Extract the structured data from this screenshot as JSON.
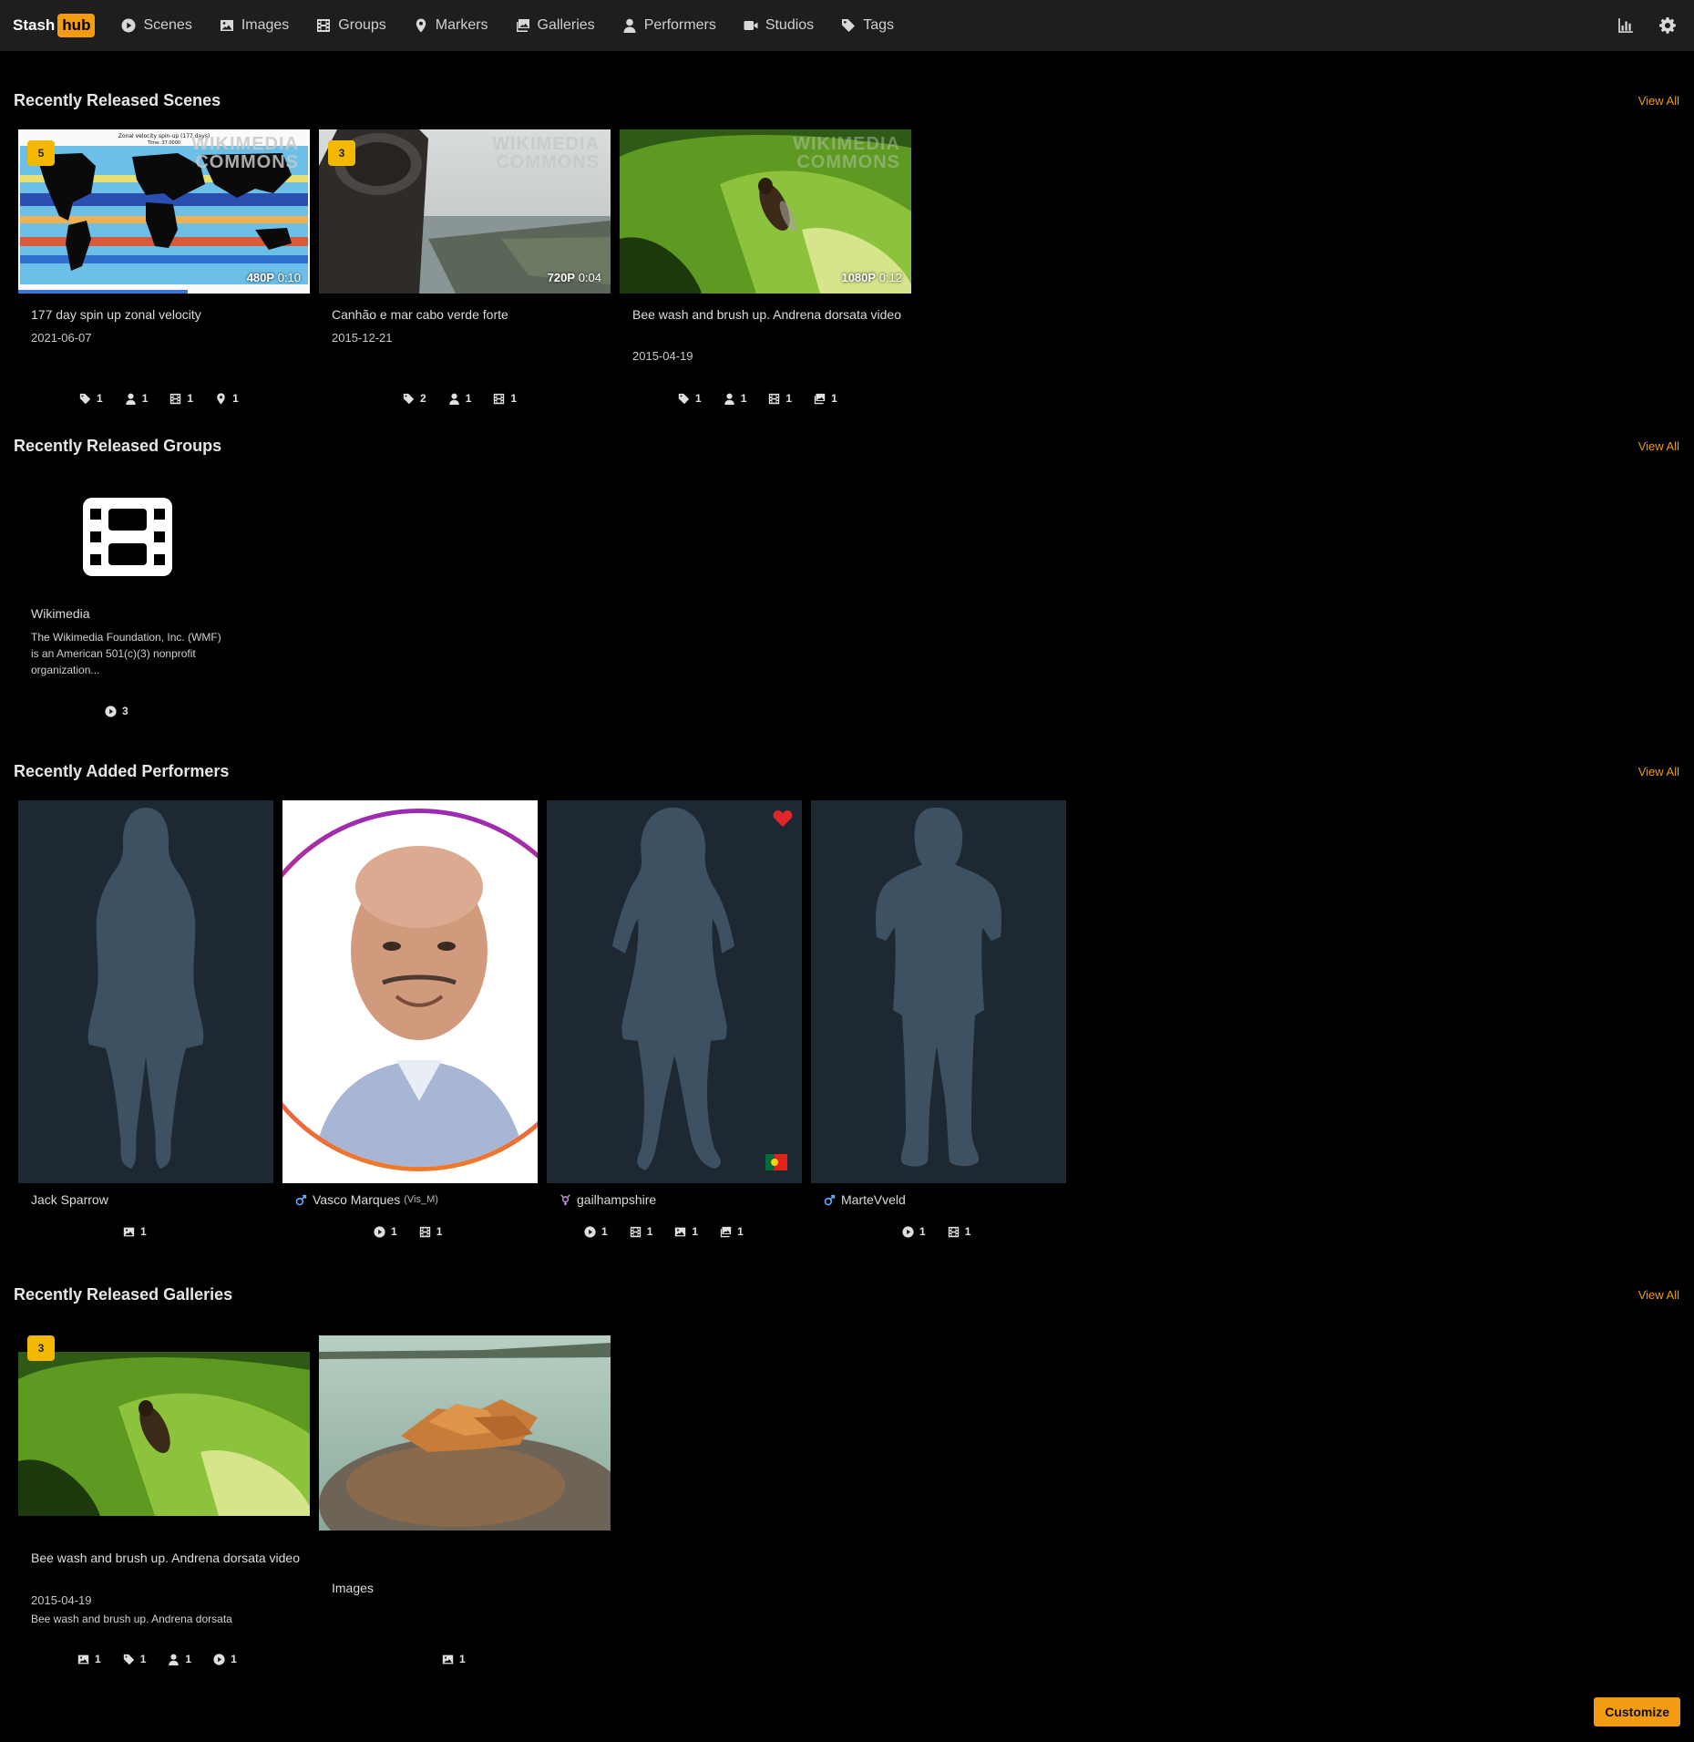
{
  "nav": {
    "logo_left": "Stash",
    "logo_right": "hub",
    "items": [
      {
        "label": "Scenes",
        "icon": "play-circle-icon"
      },
      {
        "label": "Images",
        "icon": "image-icon"
      },
      {
        "label": "Groups",
        "icon": "film-icon"
      },
      {
        "label": "Markers",
        "icon": "map-marker-icon"
      },
      {
        "label": "Galleries",
        "icon": "images-icon"
      },
      {
        "label": "Performers",
        "icon": "user-icon"
      },
      {
        "label": "Studios",
        "icon": "video-icon"
      },
      {
        "label": "Tags",
        "icon": "tag-icon"
      }
    ]
  },
  "sections": {
    "scenes_title": "Recently Released Scenes",
    "groups_title": "Recently Released Groups",
    "performers_title": "Recently Added Performers",
    "galleries_title": "Recently Released Galleries",
    "view_all": "View All"
  },
  "scenes": [
    {
      "badge": "5",
      "res": "480P",
      "duration": "0:10",
      "title": "177 day spin up zonal velocity",
      "date": "2021-06-07",
      "counts": {
        "tags": "1",
        "performers": "1",
        "groups": "1",
        "markers": "1"
      },
      "progress": 0.58
    },
    {
      "badge": "3",
      "res": "720P",
      "duration": "0:04",
      "title": "Canhão e mar cabo verde forte",
      "date": "2015-12-21",
      "counts": {
        "tags": "2",
        "performers": "1",
        "groups": "1"
      }
    },
    {
      "res": "1080P",
      "duration": "0:12",
      "title": "Bee wash and brush up. Andrena dorsata video",
      "date": "2015-04-19",
      "counts": {
        "tags": "1",
        "performers": "1",
        "groups": "1",
        "galleries": "1"
      }
    }
  ],
  "scene_thumb_texts": {
    "watermark_1": "WIKIMEDIA",
    "watermark_2": "COMMONS",
    "map_title": "Zonal velocity spin-up (177 days)",
    "map_sub": "Time: 37.0000"
  },
  "group": {
    "title": "Wikimedia",
    "desc": "The Wikimedia Foundation, Inc. (WMF) is an American 501(c)(3) nonprofit organization...",
    "scenes": "3"
  },
  "performers": [
    {
      "name": "Jack Sparrow",
      "counts": {
        "images": "1"
      }
    },
    {
      "name": "Vasco Marques",
      "disambig": "(Vis_M)",
      "gender": "male",
      "counts": {
        "scenes": "1",
        "groups": "1"
      }
    },
    {
      "name": "gailhampshire",
      "gender": "trans",
      "favorite": true,
      "counts": {
        "scenes": "1",
        "groups": "1",
        "images": "1",
        "galleries": "1"
      }
    },
    {
      "name": "MarteVveld",
      "gender": "male",
      "counts": {
        "scenes": "1",
        "groups": "1"
      }
    }
  ],
  "galleries": [
    {
      "badge": "3",
      "title": "Bee wash and brush up. Andrena dorsata video",
      "date": "2015-04-19",
      "desc": "Bee wash and brush up. Andrena dorsata",
      "counts": {
        "images": "1",
        "tags": "1",
        "performers": "1",
        "scenes": "1"
      }
    },
    {
      "title": "Images",
      "counts": {
        "images": "1"
      }
    }
  ],
  "colors": {
    "accent": "#f39c12",
    "badge": "#f5b800",
    "favorite": "#e0262b",
    "male": "#66aaff",
    "trans": "#c48bd8"
  },
  "customize_label": "Customize"
}
